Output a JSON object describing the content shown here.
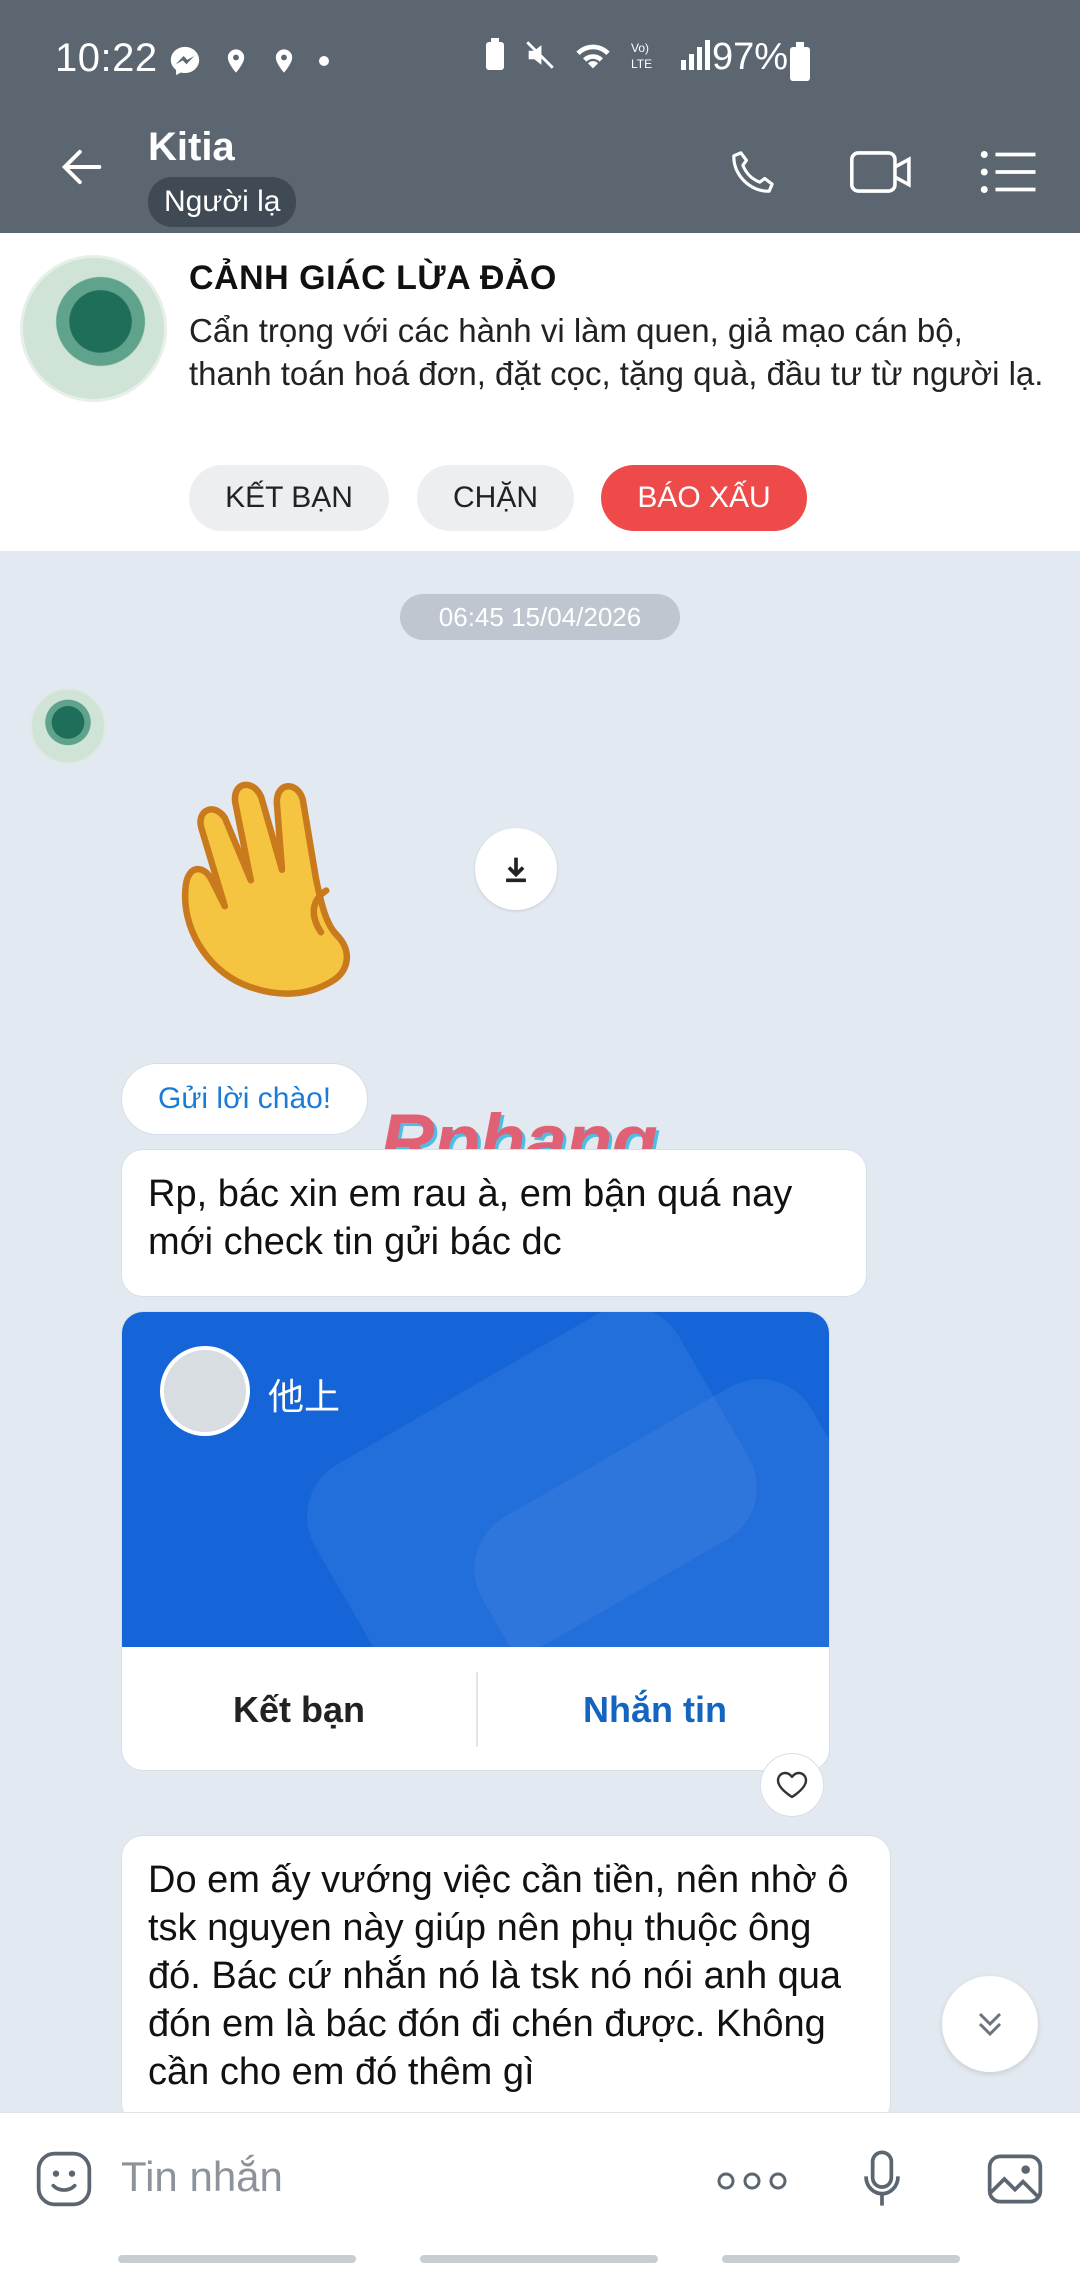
{
  "status_bar": {
    "time": "10:22",
    "battery": "97%"
  },
  "header": {
    "name": "Kitia",
    "badge": "Người lạ"
  },
  "warning": {
    "title": "CẢNH GIÁC LỪA ĐẢO",
    "text": "Cẩn trọng với các hành vi làm quen, giả mạo cán bộ, thanh toán hoá đơn, đặt cọc, tặng quà, đầu tư từ người lạ.",
    "buttons": {
      "add_friend": "KẾT BẠN",
      "block": "CHẶN",
      "report": "BÁO XẤU"
    }
  },
  "chat": {
    "timestamp": "06:45 15/04/2026",
    "greeting_button": "Gửi lời chào!",
    "watermark": "Rphang",
    "message1": "Rp, bác xin em rau à, em bận quá nay mới check tin gửi bác dc",
    "contact_card": {
      "name": "他上",
      "add_friend": "Kết bạn",
      "message": "Nhắn tin"
    },
    "message2": "Do em ấy vướng việc cần tiền, nên nhờ ô tsk nguyen này giúp nên phụ thuộc ông đó. Bác cứ nhắn nó là tsk nó nói anh qua đón em là bác đón đi chén được. Không cần cho em đó thêm gì"
  },
  "composer": {
    "placeholder": "Tin nhắn"
  },
  "colors": {
    "header_bg": "#5b6670",
    "chat_bg": "#e2e9f1",
    "accent_blue": "#1565d8",
    "report_red": "#ef4a4a"
  }
}
